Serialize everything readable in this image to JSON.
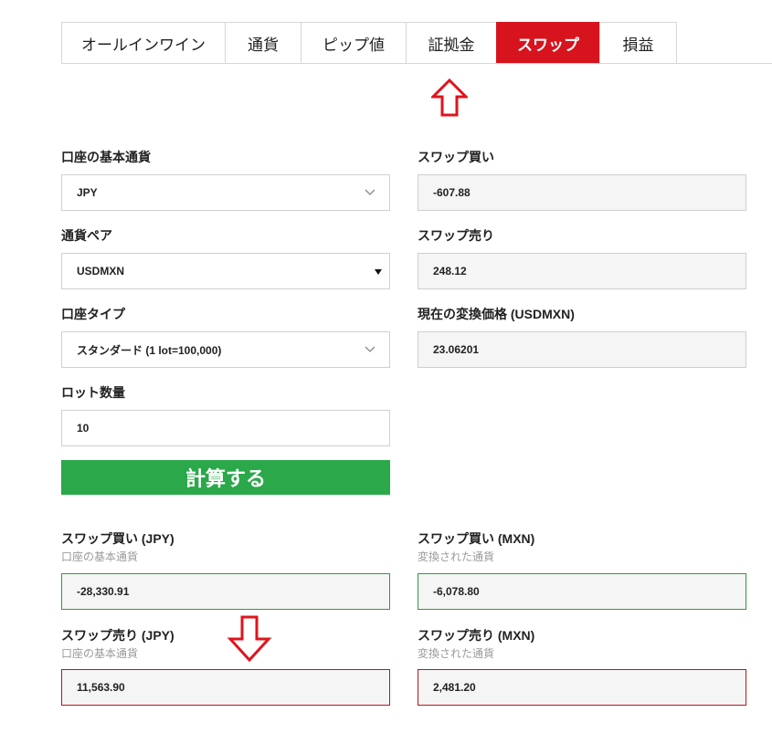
{
  "tabs": [
    {
      "label": "オールインワイン"
    },
    {
      "label": "通貨"
    },
    {
      "label": "ピップ値"
    },
    {
      "label": "証拠金"
    },
    {
      "label": "スワップ"
    },
    {
      "label": "損益"
    }
  ],
  "form": {
    "base_currency_label": "口座の基本通貨",
    "base_currency_value": "JPY",
    "pair_label": "通貨ペア",
    "pair_value": "USDMXN",
    "account_type_label": "口座タイプ",
    "account_type_value": "スタンダード (1 lot=100,000)",
    "lots_label": "ロット数量",
    "lots_value": "10",
    "calc_button": "計算する"
  },
  "rates": {
    "swap_buy_label": "スワップ買い",
    "swap_buy_value": "-607.88",
    "swap_sell_label": "スワップ売り",
    "swap_sell_value": "248.12",
    "conversion_label": "現在の変換価格 (USDMXN)",
    "conversion_value": "23.06201"
  },
  "results": {
    "buy_jpy_label": "スワップ買い (JPY)",
    "buy_jpy_sub": "口座の基本通貨",
    "buy_jpy_value": "-28,330.91",
    "buy_mxn_label": "スワップ買い (MXN)",
    "buy_mxn_sub": "変換された通貨",
    "buy_mxn_value": "-6,078.80",
    "sell_jpy_label": "スワップ売り (JPY)",
    "sell_jpy_sub": "口座の基本通貨",
    "sell_jpy_value": "11,563.90",
    "sell_mxn_label": "スワップ売り (MXN)",
    "sell_mxn_sub": "変換された通貨",
    "sell_mxn_value": "2,481.20"
  },
  "colors": {
    "accent_red": "#d7141e",
    "button_green": "#2aa84a",
    "positive_border": "#2e9c3a",
    "negative_border": "#c0121a"
  },
  "icons": [
    "chevron-down-icon",
    "dropdown-triangle-icon",
    "up-arrow-icon",
    "down-arrow-icon"
  ]
}
